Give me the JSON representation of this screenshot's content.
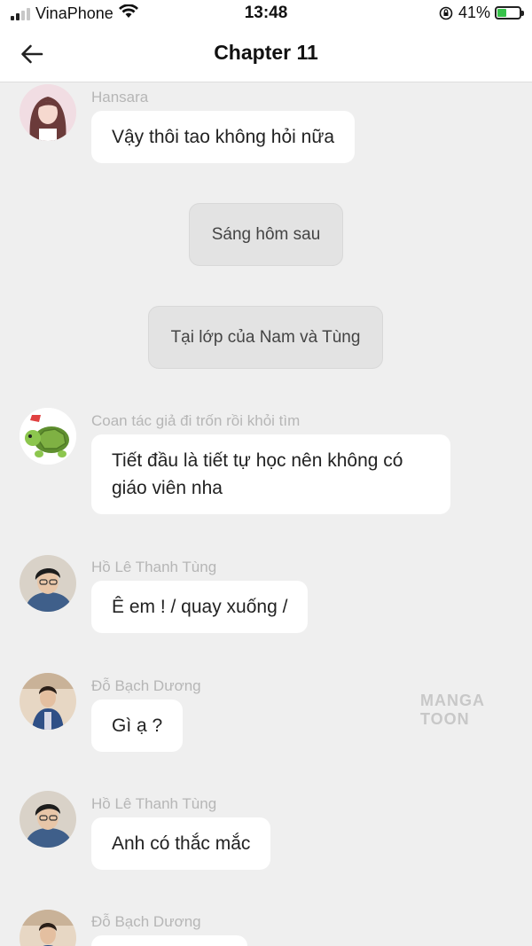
{
  "status_bar": {
    "carrier": "VinaPhone",
    "time": "13:48",
    "battery_percent": "41%",
    "battery_level": 0.41,
    "icons": [
      "signal-icon",
      "wifi-icon",
      "rotation-lock-icon",
      "battery-charging-icon"
    ]
  },
  "header": {
    "title": "Chapter 11",
    "back_icon": "arrow-left-icon"
  },
  "messages": [
    {
      "type": "chat",
      "sender": "Hansara",
      "text": "Vậy thôi tao không hỏi nữa",
      "avatar": "hansara"
    },
    {
      "type": "narration",
      "text": "Sáng hôm sau"
    },
    {
      "type": "narration",
      "text": "Tại lớp của Nam và Tùng"
    },
    {
      "type": "chat",
      "sender": "Coan tác giả đi trốn rồi khỏi tìm",
      "text": "Tiết đầu là tiết tự học nên không có giáo viên nha",
      "avatar": "turtle"
    },
    {
      "type": "chat",
      "sender": "Hồ Lê Thanh Tùng",
      "text": "Ê em ! / quay xuống /",
      "avatar": "tung"
    },
    {
      "type": "chat",
      "sender": "Đỗ Bạch Dương",
      "text": "Gì ạ ?",
      "avatar": "duong"
    },
    {
      "type": "chat",
      "sender": "Hồ Lê Thanh Tùng",
      "text": "Anh có thắc mắc",
      "avatar": "tung"
    },
    {
      "type": "chat",
      "sender": "Đỗ Bạch Dương",
      "text": "",
      "avatar": "duong"
    }
  ],
  "watermark": "MANGA TOON"
}
